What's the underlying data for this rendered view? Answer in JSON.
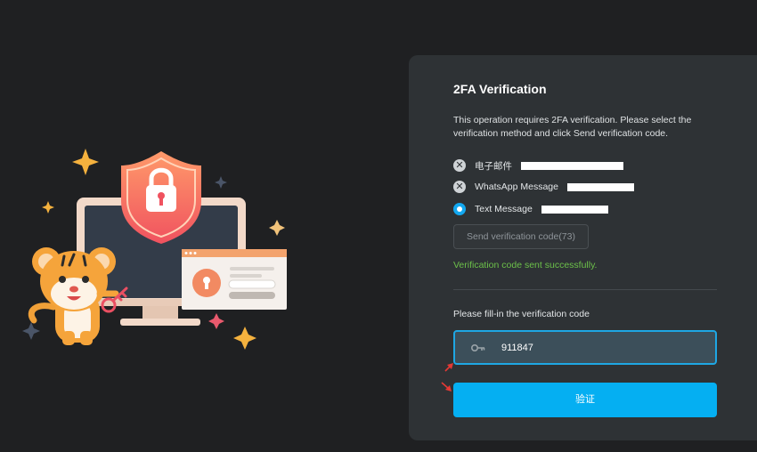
{
  "panel": {
    "title": "2FA Verification",
    "description": "This operation requires 2FA verification. Please select the verification method and click Send verification code.",
    "methods": [
      {
        "label": "电子邮件",
        "state": "disabled"
      },
      {
        "label": "WhatsApp Message",
        "state": "disabled"
      },
      {
        "label": "Text Message",
        "state": "selected"
      }
    ],
    "send_button_label": "Send verification code(73)",
    "success_message": "Verification code sent successfully.",
    "input_label": "Please fill-in the verification code",
    "code_value": "911847",
    "verify_button_label": "验证"
  },
  "colors": {
    "background": "#1f2022",
    "panel": "#2e3235",
    "accent": "#05aff2",
    "success": "#6cc04a",
    "arrow": "#e53935"
  },
  "icons": {
    "disabled_mark": "close-circle-icon",
    "selected_mark": "radio-selected-icon",
    "input_prefix": "key-icon"
  }
}
